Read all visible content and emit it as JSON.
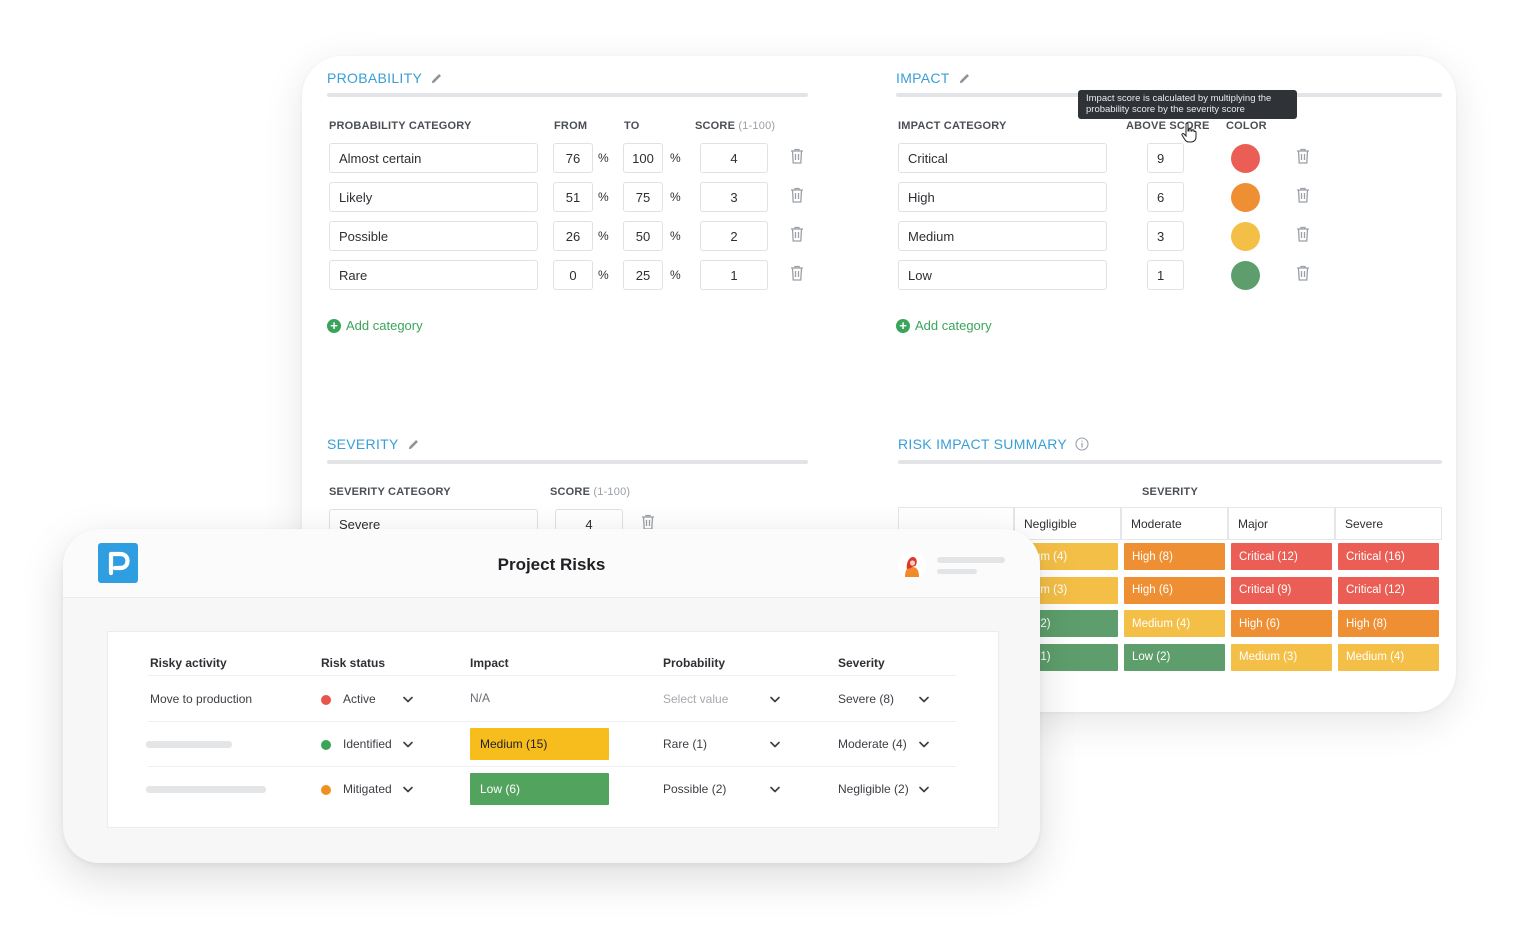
{
  "probability": {
    "title": "PROBABILITY",
    "col_category": "PROBABILITY CATEGORY",
    "col_from": "FROM",
    "col_to": "TO",
    "col_score": "SCORE",
    "col_score_range": "(1-100)",
    "rows": [
      {
        "category": "Almost certain",
        "from": "76",
        "to": "100",
        "score": "4"
      },
      {
        "category": "Likely",
        "from": "51",
        "to": "75",
        "score": "3"
      },
      {
        "category": "Possible",
        "from": "26",
        "to": "50",
        "score": "2"
      },
      {
        "category": "Rare",
        "from": "0",
        "to": "25",
        "score": "1"
      }
    ],
    "percent_sign": "%",
    "add_label": "Add category"
  },
  "impact": {
    "title": "IMPACT",
    "tooltip": "Impact score is calculated by multiplying the probability score by the severity score",
    "col_category": "IMPACT CATEGORY",
    "col_above": "ABOVE SCORE",
    "col_color": "COLOR",
    "rows": [
      {
        "category": "Critical",
        "above": "9",
        "color": "#ea5e55"
      },
      {
        "category": "High",
        "above": "6",
        "color": "#ef8f33"
      },
      {
        "category": "Medium",
        "above": "3",
        "color": "#f4bf46"
      },
      {
        "category": "Low",
        "above": "1",
        "color": "#5e9e6c"
      }
    ],
    "add_label": "Add category"
  },
  "severity": {
    "title": "SEVERITY",
    "col_category": "SEVERITY CATEGORY",
    "col_score": "SCORE",
    "col_score_range": "(1-100)",
    "rows": [
      {
        "category": "Severe",
        "score": "4"
      }
    ]
  },
  "summary": {
    "title": "RISK IMPACT SUMMARY",
    "axis_label": "SEVERITY",
    "columns": [
      "Negligible",
      "Moderate",
      "Major",
      "Severe"
    ],
    "rows": [
      [
        {
          "label": "dium (4)",
          "color": "yellow"
        },
        {
          "label": "High (8)",
          "color": "orange"
        },
        {
          "label": "Critical (12)",
          "color": "red"
        },
        {
          "label": "Critical (16)",
          "color": "red"
        }
      ],
      [
        {
          "label": "dium (3)",
          "color": "yellow"
        },
        {
          "label": "High (6)",
          "color": "orange"
        },
        {
          "label": "Critical (9)",
          "color": "red"
        },
        {
          "label": "Critical (12)",
          "color": "red"
        }
      ],
      [
        {
          "label": "w (2)",
          "color": "green"
        },
        {
          "label": "Medium (4)",
          "color": "yellow"
        },
        {
          "label": "High (6)",
          "color": "orange"
        },
        {
          "label": "High (8)",
          "color": "orange"
        }
      ],
      [
        {
          "label": "w (1)",
          "color": "green"
        },
        {
          "label": "Low (2)",
          "color": "green"
        },
        {
          "label": "Medium (3)",
          "color": "yellow"
        },
        {
          "label": "Medium (4)",
          "color": "yellow"
        }
      ]
    ]
  },
  "project": {
    "title": "Project Risks",
    "brand_color": "#2f9ee0",
    "logo_icon": "p-logo",
    "headers": {
      "activity": "Risky activity",
      "status": "Risk status",
      "impact": "Impact",
      "probability": "Probability",
      "severity": "Severity"
    },
    "rows": [
      {
        "activity": "Move to production",
        "status": "Active",
        "status_color": "#e8534a",
        "impact": "N/A",
        "impact_color": "",
        "probability": "Select value",
        "severity": "Severe (8)"
      },
      {
        "activity": "",
        "status": "Identified",
        "status_color": "#3aa55a",
        "impact": "Medium (15)",
        "impact_color": "#f6bd1d",
        "probability": "Rare (1)",
        "severity": "Moderate (4)"
      },
      {
        "activity": "",
        "status": "Mitigated",
        "status_color": "#f0901e",
        "impact": "Low (6)",
        "impact_color": "#52a35e",
        "probability": "Possible (2)",
        "severity": "Negligible (2)"
      }
    ]
  }
}
